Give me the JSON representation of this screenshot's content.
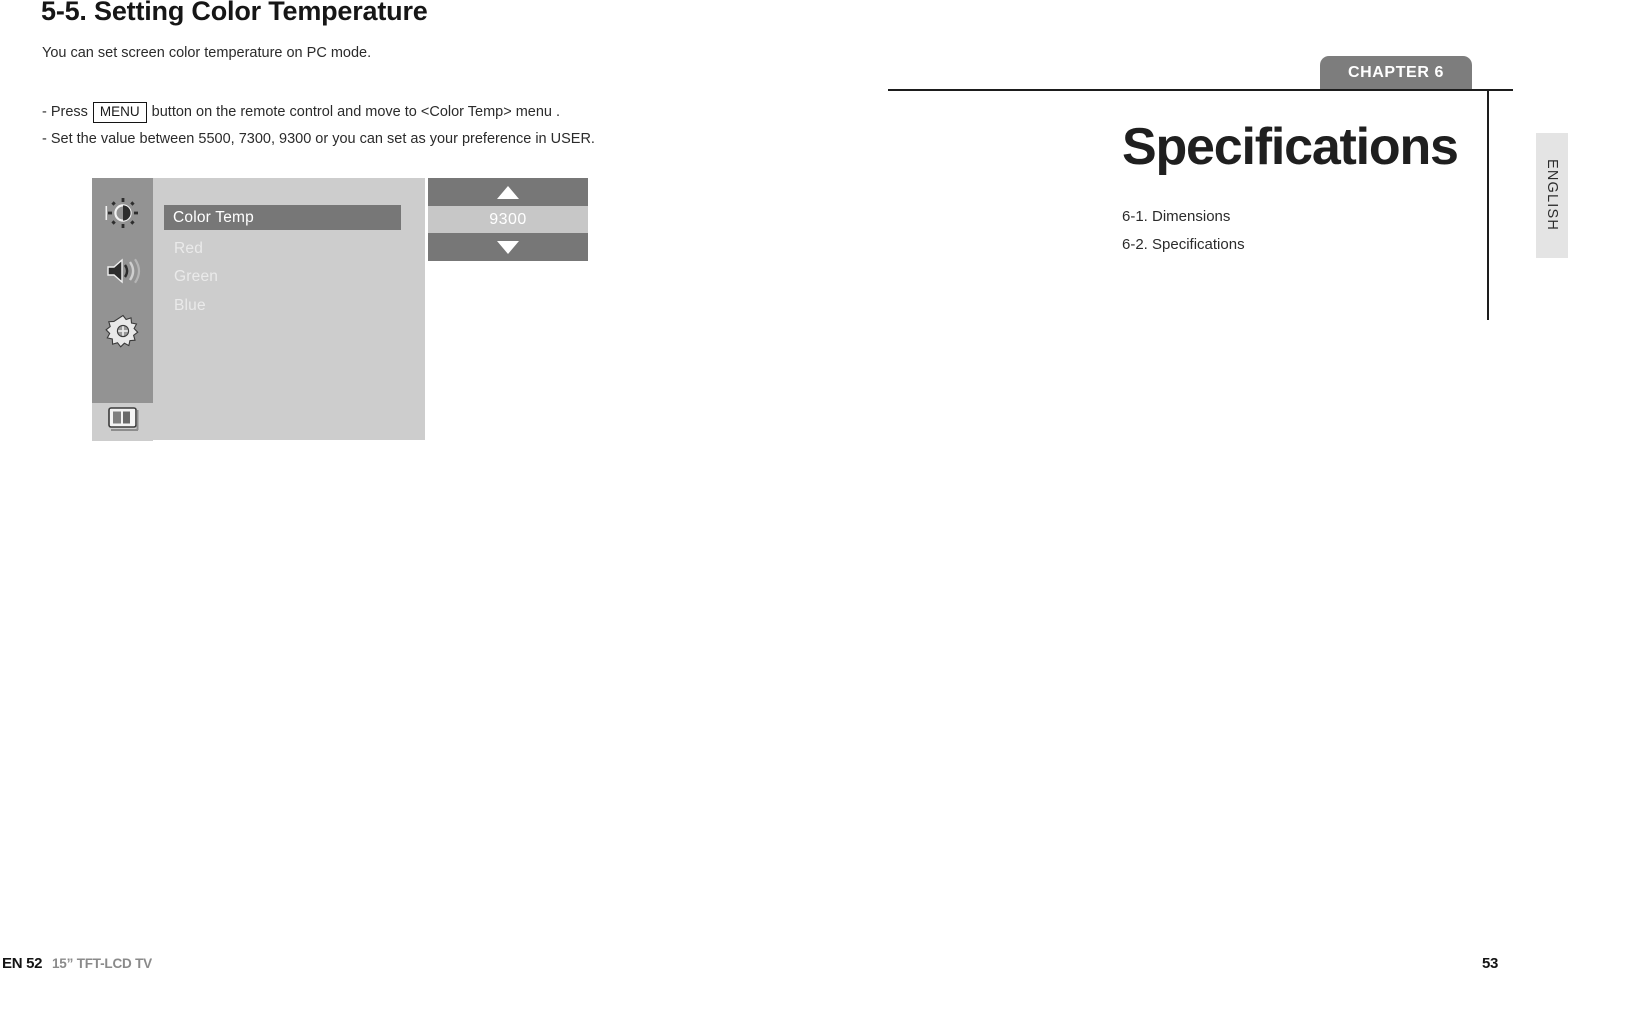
{
  "left_page": {
    "section_title": "5-5. Setting Color Temperature",
    "intro": "You can set screen color temperature on PC mode.",
    "instructions": {
      "line1_before": "- Press",
      "menu_key_label": "MENU",
      "line1_after": "button on the remote control and move to <Color Temp> menu .",
      "line2": "- Set the value between 5500, 7300, 9300 or you can set as your preference in USER."
    },
    "osd": {
      "sidebar_icons": [
        {
          "name": "picture-icon",
          "label": "Picture"
        },
        {
          "name": "sound-icon",
          "label": "Sound"
        },
        {
          "name": "setup-icon",
          "label": "Setup"
        },
        {
          "name": "screen-icon",
          "label": "Screen"
        }
      ],
      "selected_item": "Color Temp",
      "items": [
        "Red",
        "Green",
        "Blue"
      ],
      "stepper": {
        "value": "9300",
        "up_arrow": "up-arrow-icon",
        "down_arrow": "down-arrow-icon"
      },
      "colors": {
        "sidebar_bg": "#939393",
        "panel_bg": "#cdcdcd",
        "highlight_bg": "#777777",
        "value_bg": "#c7c7c7",
        "text_selected": "#ffffff",
        "text_dim": "#eaeaea"
      }
    }
  },
  "right_page": {
    "chapter_tab": "CHAPTER 6",
    "chapter_title": "Specifications",
    "chapter_items": [
      "6-1. Dimensions",
      "6-2. Specifications"
    ],
    "accent_color": "#7d7d7d"
  },
  "language_tab": {
    "label": "ENGLISH"
  },
  "footer": {
    "left_page_number": "EN 52",
    "model": "15” TFT-LCD TV",
    "right_page_number": "53"
  }
}
